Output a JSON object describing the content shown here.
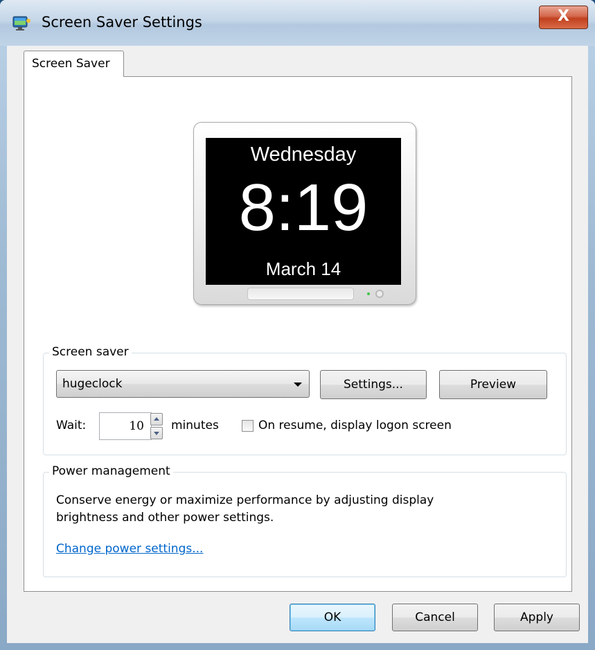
{
  "window": {
    "title": "Screen Saver Settings",
    "close_label": "X"
  },
  "tabs": [
    {
      "label": "Screen Saver",
      "active": true
    }
  ],
  "preview": {
    "day": "Wednesday",
    "time": "8:19",
    "date": "March 14"
  },
  "screen_saver_group": {
    "label": "Screen saver",
    "selected": "hugeclock",
    "settings_label": "Settings...",
    "preview_label": "Preview",
    "wait_label": "Wait:",
    "wait_value": "10",
    "minutes_label": "minutes",
    "resume_label": "On resume, display logon screen",
    "resume_checked": false
  },
  "power_group": {
    "label": "Power management",
    "description": "Conserve energy or maximize performance by adjusting display brightness and other power settings.",
    "link_label": "Change power settings..."
  },
  "footer": {
    "ok_label": "OK",
    "cancel_label": "Cancel",
    "apply_label": "Apply"
  },
  "colors": {
    "accent_link": "#0066cc",
    "close_button": "#c0411f",
    "preview_background": "#000000"
  },
  "icons": [
    "screen-saver-app-icon",
    "chevron-down-icon",
    "spin-up-icon",
    "spin-down-icon"
  ]
}
